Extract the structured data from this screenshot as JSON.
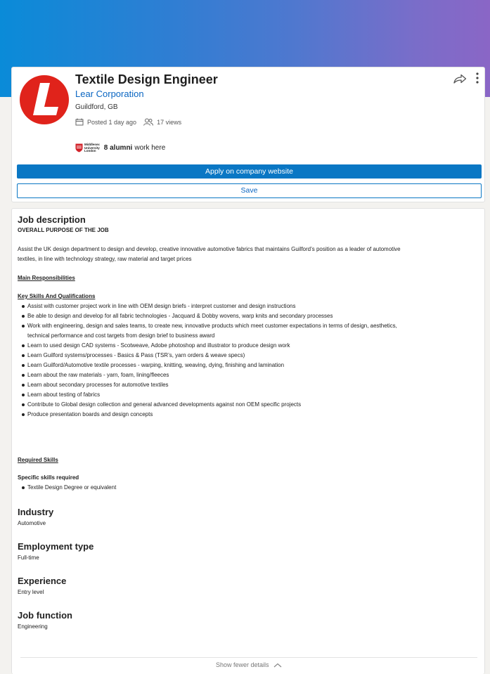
{
  "job": {
    "title": "Textile Design Engineer",
    "company": "Lear Corporation",
    "location": "Guildford, GB",
    "posted": "Posted 1 day ago",
    "views": "17 views",
    "alumni_count": "8 alumni",
    "alumni_suffix": "work here",
    "university_logo_text": [
      "Middlesex",
      "University",
      "London"
    ]
  },
  "actions": {
    "apply_label": "Apply on company website",
    "save_label": "Save"
  },
  "description": {
    "heading": "Job description",
    "purpose_heading": "OVERALL PURPOSE OF THE JOB",
    "purpose_text_1": "Assist the UK design department to design and develop, creative innovative automotive fabrics that maintains Guilford’s position as a leader of automotive",
    "purpose_text_2": "textiles, in line with technology strategy, raw material and target prices",
    "main_responsibilities": "Main Responsibilities",
    "key_skills": "Key Skills And Qualifications",
    "bullets": [
      "Assist with customer project work in line with OEM design briefs - interpret customer and design instructions",
      "Be able to design and develop for all fabric technologies - Jacquard & Dobby wovens, warp knits and secondary processes",
      "Work with engineering, design and sales teams, to create new, innovative products which meet customer expectations in terms of design, aesthetics,",
      "technical performance and cost targets from design brief to business award",
      "Learn to used design CAD systems - Scotweave, Adobe photoshop and illustrator to produce design work",
      "Learn Guilford systems/processes - Basics & Pass (TSR’s, yarn orders & weave specs)",
      "Learn Guilford/Automotive textile processes - warping, knitting, weaving, dying, finishing and lamination",
      "Learn about the raw materials - yarn, foam, lining/fleeces",
      "Learn about secondary processes for automotive textiles",
      "Learn about testing of fabrics",
      "Contribute to Global design collection and general advanced developments against non OEM specific projects",
      "Produce presentation boards and design concepts"
    ],
    "required_skills": "Required Skills",
    "specific_skills": "Specific skills required",
    "specific_bullets": [
      "Textile Design Degree or equivalent"
    ]
  },
  "criteria": {
    "industry_label": "Industry",
    "industry_value": "Automotive",
    "employment_label": "Employment type",
    "employment_value": "Full-time",
    "experience_label": "Experience",
    "experience_value": "Entry level",
    "function_label": "Job function",
    "function_value": "Engineering"
  },
  "footer": {
    "show_fewer": "Show fewer details"
  },
  "colors": {
    "accent": "#0a77c4",
    "link": "#0a66c2",
    "logo_red": "#e0231b"
  },
  "icons": [
    "share-icon",
    "more-options-icon",
    "calendar-icon",
    "people-icon",
    "chevron-up-icon"
  ]
}
